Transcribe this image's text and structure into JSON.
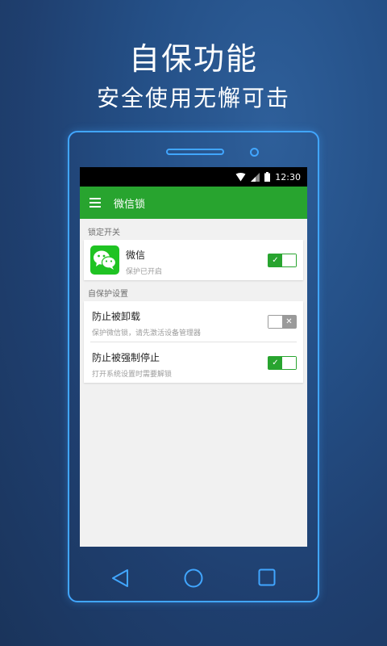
{
  "promo": {
    "title": "自保功能",
    "subtitle": "安全使用无懈可击"
  },
  "status_bar": {
    "time": "12:30",
    "icons": [
      "wifi-icon",
      "signal-icon",
      "battery-icon"
    ]
  },
  "app_bar": {
    "title": "微信锁",
    "menu_icon": "menu-icon"
  },
  "sections": [
    {
      "header": "锁定开关",
      "items": [
        {
          "title": "微信",
          "description": "保护已开启",
          "enabled": true,
          "icon": "wechat-icon"
        }
      ]
    },
    {
      "header": "自保护设置",
      "items": [
        {
          "title": "防止被卸载",
          "description": "保护微信锁，请先激活设备管理器",
          "enabled": false
        },
        {
          "title": "防止被强制停止",
          "description": "打开系统设置时需要解锁",
          "enabled": true
        }
      ]
    }
  ],
  "colors": {
    "accent": "#28a42f",
    "wechat_green": "#1fc323",
    "phone_outline": "#41a6ff",
    "toggle_off": "#9a9a9a"
  },
  "nav_buttons": [
    "back-icon",
    "home-icon",
    "recent-apps-icon"
  ]
}
